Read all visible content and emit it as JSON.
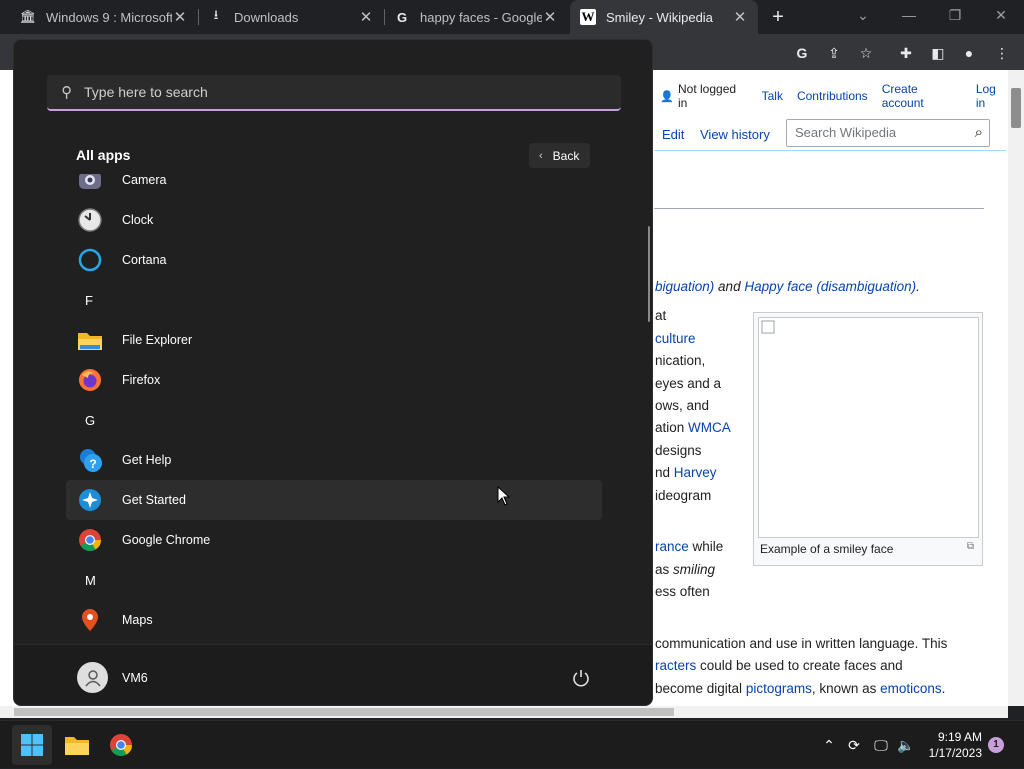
{
  "browser": {
    "tabs": [
      {
        "label": "Windows 9 : Microsoft",
        "icon": "institution-icon",
        "active": false
      },
      {
        "label": "Downloads",
        "icon": "download-icon",
        "active": false
      },
      {
        "label": "happy faces - Google S",
        "icon": "google-icon",
        "active": false
      },
      {
        "label": "Smiley - Wikipedia",
        "icon": "wikipedia-icon",
        "active": true
      }
    ],
    "new_tab": "+",
    "window_controls": {
      "tabsearch": "⌄",
      "minimize": "—",
      "restore": "❐",
      "close": "✕"
    }
  },
  "wikipedia": {
    "top_links": {
      "not_logged_in": "Not logged in",
      "talk": "Talk",
      "contributions": "Contributions",
      "create_account": "Create account",
      "login": "Log in"
    },
    "tabs": {
      "edit": "Edit",
      "history": "View history"
    },
    "search_placeholder": "Search Wikipedia",
    "hatnote": {
      "part1": "biguation)",
      "mid": " and ",
      "link": "Happy face (disambiguation)",
      "end": "."
    },
    "lines": [
      {
        "pre": "at",
        "link": "",
        "post": ""
      },
      {
        "pre": "",
        "link": "culture",
        "post": ""
      },
      {
        "pre": "nication,",
        "link": "",
        "post": ""
      },
      {
        "pre": " eyes and a",
        "link": "",
        "post": ""
      },
      {
        "pre": "ows, and",
        "link": "",
        "post": ""
      },
      {
        "pre": "ation ",
        "link": "WMCA",
        "post": ""
      },
      {
        "pre": "designs",
        "link": "",
        "post": ""
      },
      {
        "pre": "nd ",
        "link": "Harvey",
        "post": ""
      },
      {
        "pre": " ideogram",
        "link": "",
        "post": ""
      }
    ],
    "lines2": [
      {
        "link": "rance",
        "post": " while"
      },
      {
        "pre": " as ",
        "ital": "smiling"
      },
      {
        "pre": "ess often"
      }
    ],
    "para2": [
      {
        "pre": "communication and use in written language. This",
        "link": "",
        "post": ""
      },
      {
        "pre": "",
        "link": "racters",
        "post": " could be used to create faces and"
      },
      {
        "pre": "become digital ",
        "link": "pictograms",
        "post": ", known as ",
        "link2": "emoticons",
        "post2": "."
      }
    ],
    "infobox_caption": "Example of a smiley face"
  },
  "start_menu": {
    "search_placeholder": "Type here to search",
    "all_apps_label": "All apps",
    "back_label": "Back",
    "apps": [
      {
        "type": "app",
        "label": "Camera",
        "icon": "camera-icon"
      },
      {
        "type": "app",
        "label": "Clock",
        "icon": "clock-icon"
      },
      {
        "type": "app",
        "label": "Cortana",
        "icon": "cortana-icon"
      },
      {
        "type": "letter",
        "label": "F"
      },
      {
        "type": "app",
        "label": "File Explorer",
        "icon": "folder-icon"
      },
      {
        "type": "app",
        "label": "Firefox",
        "icon": "firefox-icon"
      },
      {
        "type": "letter",
        "label": "G"
      },
      {
        "type": "app",
        "label": "Get Help",
        "icon": "help-icon"
      },
      {
        "type": "app",
        "label": "Get Started",
        "icon": "get-started-icon"
      },
      {
        "type": "app",
        "label": "Google Chrome",
        "icon": "chrome-icon"
      },
      {
        "type": "letter",
        "label": "M"
      },
      {
        "type": "app",
        "label": "Maps",
        "icon": "maps-icon"
      }
    ],
    "user_name": "VM6"
  },
  "taskbar": {
    "time": "9:19 AM",
    "date": "1/17/2023",
    "notification_count": "1"
  }
}
